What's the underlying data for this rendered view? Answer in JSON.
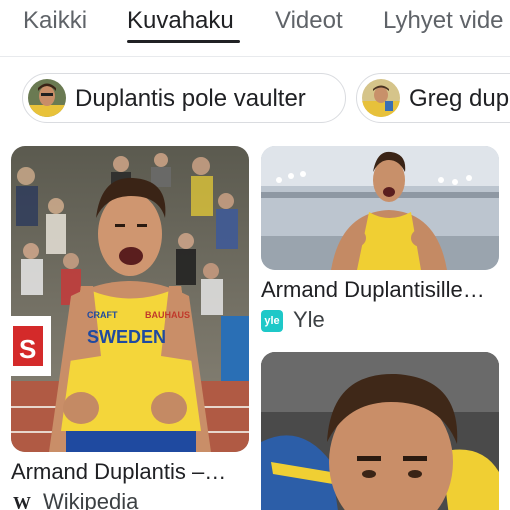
{
  "tabs": [
    {
      "label": "Kaikki"
    },
    {
      "label": "Kuvahaku"
    },
    {
      "label": "Videot"
    },
    {
      "label": "Lyhyet vide"
    }
  ],
  "chips": [
    {
      "label": "Duplantis pole vaulter"
    },
    {
      "label": "Greg dup"
    }
  ],
  "results": [
    {
      "title": "Armand Duplantis –…",
      "source": "Wikipedia",
      "source_icon": "W",
      "jersey_text": "SWEDEN",
      "jersey_brand": "CRAFT",
      "jersey_sponsor": "BAUHAUS"
    },
    {
      "title": "Armand Duplantisille…",
      "source": "Yle",
      "source_icon": "yle"
    },
    {
      "title": "",
      "source": ""
    }
  ],
  "colors": {
    "active_tab": "#202124",
    "inactive_tab": "#5f6368",
    "jersey_yellow": "#f4d63a",
    "sweden_blue": "#1f4aa0",
    "yle_teal": "#1ec8c8"
  }
}
